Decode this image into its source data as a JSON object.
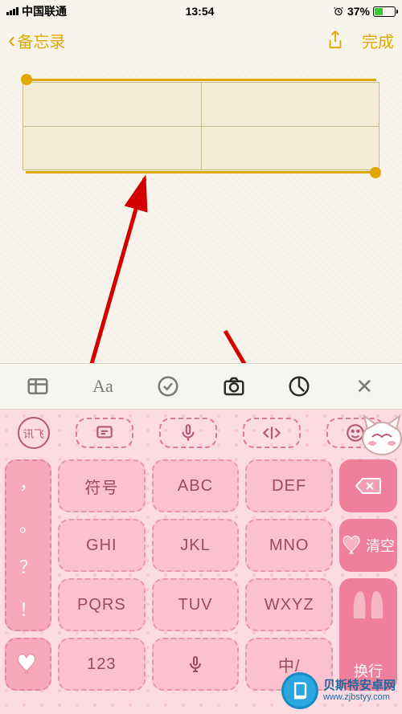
{
  "status": {
    "carrier": "中国联通",
    "time": "13:54",
    "battery_pct": "37%",
    "battery_fill_pct": 37
  },
  "nav": {
    "back_label": "备忘录",
    "done_label": "完成"
  },
  "toolbar": {
    "items": [
      "table",
      "text-style",
      "checklist",
      "camera",
      "markup",
      "close"
    ]
  },
  "keyboard": {
    "logo": "讯飞",
    "top_icons": [
      "messages",
      "mic",
      "code",
      "emoji"
    ],
    "side_punct": [
      "，",
      "。",
      "？",
      "！"
    ],
    "rows": [
      [
        "符号",
        "ABC",
        "DEF"
      ],
      [
        "GHI",
        "JKL",
        "MNO"
      ],
      [
        "PQRS",
        "TUV",
        "WXYZ"
      ],
      [
        "123",
        "mic",
        "中/"
      ]
    ],
    "right": {
      "backspace": "⌫",
      "clear": "清空",
      "enter": "换行"
    }
  },
  "watermark": {
    "name": "贝斯特安卓网",
    "url": "www.zjbstyy.com"
  }
}
